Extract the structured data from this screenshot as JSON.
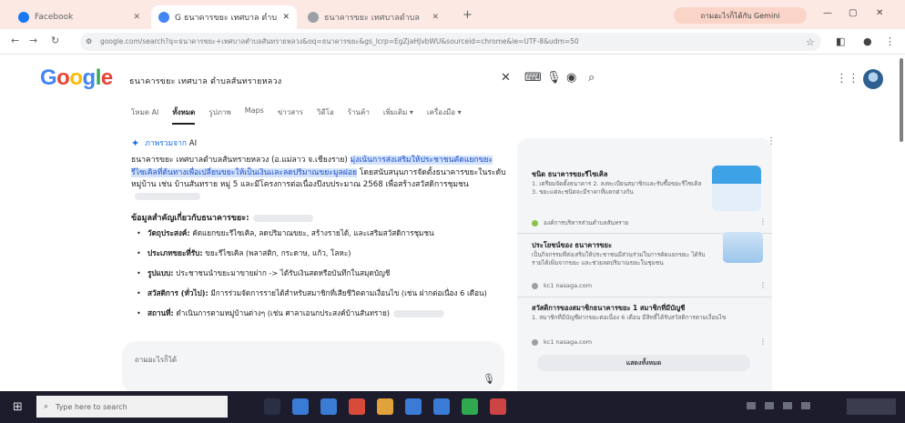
{
  "browser": {
    "tabs": [
      {
        "title": "Facebook",
        "favicon_color": "#1877f2",
        "active": false
      },
      {
        "title": "G ธนาคารขยะ เทศบาล ตำบลสันทรายหลวง",
        "favicon_color": "#4285f4",
        "active": true
      },
      {
        "title": "ธนาคารขยะ เทศบาลตำบล",
        "favicon_color": "#9aa0a6",
        "active": false
      }
    ],
    "new_tab_icon": "plus-icon",
    "gemini_button_label": "ถามอะไรก็ได้กับ Gemini",
    "url": "google.com/search?q=ธนาคารขยะ+เทศบาลตำบลสันทรายหลวง&oq=ธนาคารขยะ&gs_lcrp=EgZjaHJvbWU&sourceid=chrome&ie=UTF-8&udm=50"
  },
  "search": {
    "logo": [
      "G",
      "o",
      "o",
      "g",
      "l",
      "e"
    ],
    "logo_colors": [
      "#4285f4",
      "#ea4335",
      "#fbbc05",
      "#4285f4",
      "#34a853",
      "#ea4335"
    ],
    "query": "ธนาคารขยะ เทศบาล ตำบลสันทรายหลวง",
    "filters": [
      "โหมด AI",
      "ทั้งหมด",
      "รูปภาพ",
      "Maps",
      "ข่าวสาร",
      "วิดีโอ",
      "ร้านค้า",
      "เพิ่มเติม ▾",
      "เครื่องมือ ▾"
    ],
    "active_filter_index": 1
  },
  "ai_overview": {
    "label": "ภาพรวมจาก",
    "label_suffix": "AI",
    "paragraph_intro": "ธนาคารขยะ เทศบาลตำบลสันทรายหลวง (อ.แม่ลาว จ.เชียงราย) ",
    "paragraph_highlight": "มุ่งเน้นการส่งเสริมให้ประชาชนคัดแยกขยะรีไซเคิลที่ต้นทางเพื่อเปลี่ยนขยะให้เป็นเงินและลดปริมาณขยะมูลฝอย",
    "paragraph_rest": " โดยสนับสนุนการจัดตั้งธนาคารขยะในระดับหมู่บ้าน เช่น บ้านสันทราย หมู่ 5 และมีโครงการต่อเนื่องปีงบประมาณ 2568 เพื่อสร้างสวัสดิการชุมชน",
    "subheading": "ข้อมูลสำคัญเกี่ยวกับธนาคารขยะ:",
    "bullets": [
      {
        "bold": "วัตถุประสงค์:",
        "text": " คัดแยกขยะรีไซเคิล, ลดปริมาณขยะ, สร้างรายได้, และเสริมสวัสดิการชุมชน"
      },
      {
        "bold": "ประเภทขยะที่รับ:",
        "text": " ขยะรีไซเคิล (พลาสติก, กระดาษ, แก้ว, โลหะ)"
      },
      {
        "bold": "รูปแบบ:",
        "text": " ประชาชนนำขยะมาขายฝาก -> ได้รับเงินสดหรือบันทึกในสมุดบัญชี"
      },
      {
        "bold": "สวัสดิการ (ทั่วไป):",
        "text": " มีการร่วมจัดการรายได้สำหรับสมาชิกที่เสียชีวิตตามเงื่อนไข (เช่น ฝากต่อเนื่อง 6 เดือน)"
      },
      {
        "bold": "สถานที่:",
        "text": " ดำเนินการตามหมู่บ้านต่างๆ (เช่น ศาลาเอนกประสงค์บ้านสันทราย)"
      }
    ],
    "ask_placeholder": "ถามอะไรก็ได้"
  },
  "sources": {
    "card1_title": "ชนิด ธนาคารขยะรีไซเคิล",
    "card1_desc": "1. เตรียมจัดตั้งธนาคาร 2. ลงทะเบียนสมาชิกและรับซื้อขยะรีไซเคิล 3. ขยะแต่ละชนิดจะมีราคาที่แตกต่างกัน",
    "card1_site": "องค์การบริหารส่วนตำบลสันทราย",
    "card2_title": "ประโยชน์ของ ธนาคารขยะ",
    "card2_desc": "เป็นกิจกรรมที่ส่งเสริมให้ประชาชนมีส่วนร่วมในการคัดแยกขยะ ได้รับรายได้เพิ่มจากขยะ และช่วยลดปริมาณขยะในชุมชน",
    "card2_site": "kc1 nasaga.com",
    "card3_title": "สวัสดิการของสมาชิกธนาคารขยะ 1 สมาชิกที่มีบัญชี",
    "card3_desc": "1. สมาชิกที่มีบัญชีฝากขยะต่อเนื่อง 6 เดือน มีสิทธิ์ได้รับสวัสดิการตามเงื่อนไข",
    "card3_site": "kc1 nasaga.com",
    "show_all": "แสดงทั้งหมด"
  },
  "taskbar": {
    "search_placeholder": "Type here to search",
    "app_icon_colors": [
      "#2b2f45",
      "#3a7bd5",
      "#3a7bd5",
      "#d84a3a",
      "#e0a23b",
      "#3a7bd5",
      "#3a7bd5",
      "#2fa84f",
      "#c44"
    ]
  },
  "colors": {
    "accent": "#1a73e8",
    "tab_bar": "#fde9e3",
    "highlight": "#d3e3fd"
  }
}
